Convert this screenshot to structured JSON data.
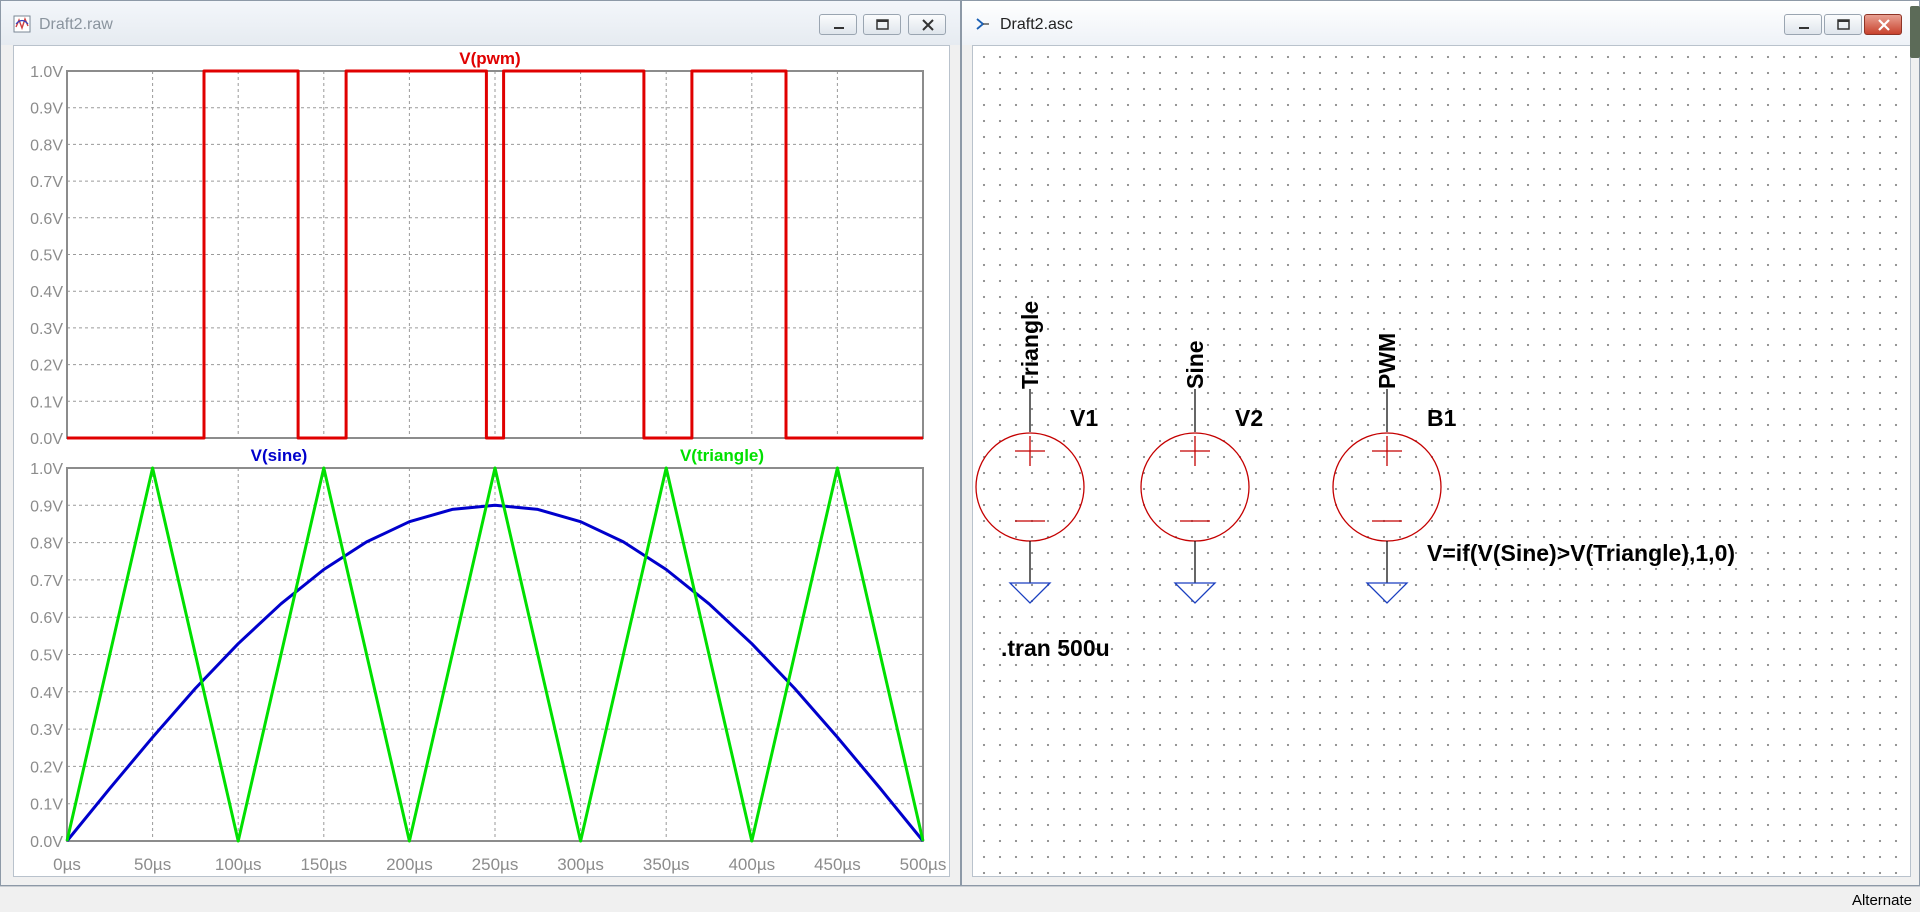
{
  "waveform_window": {
    "title": "Draft2.raw",
    "controls": [
      "minimize",
      "restore",
      "close"
    ]
  },
  "schematic_window": {
    "title": "Draft2.asc",
    "controls": [
      "minimize",
      "restore",
      "close"
    ]
  },
  "status": {
    "text": "Alternate"
  },
  "colors": {
    "pwm": "#e00000",
    "sine": "#0000cc",
    "triangle": "#00e000",
    "component": "#c40000",
    "wire": "#000000",
    "grid": "#888888"
  },
  "chart_data": [
    {
      "type": "line",
      "pane": "top",
      "series": [
        {
          "name": "V(pwm)",
          "color": "#e00000",
          "x": [
            0,
            80,
            80,
            135,
            135,
            163,
            163,
            245,
            245,
            255,
            255,
            337,
            337,
            365,
            365,
            420,
            420,
            500
          ],
          "values": [
            0,
            0,
            1,
            1,
            0,
            0,
            1,
            1,
            0,
            0,
            1,
            1,
            0,
            0,
            1,
            1,
            0,
            0
          ]
        }
      ],
      "xlim": [
        0,
        500
      ],
      "ylim": [
        0,
        1
      ],
      "y_ticks": [
        "0.0V",
        "0.1V",
        "0.2V",
        "0.3V",
        "0.4V",
        "0.5V",
        "0.6V",
        "0.7V",
        "0.8V",
        "0.9V",
        "1.0V"
      ],
      "grid": true
    },
    {
      "type": "line",
      "pane": "bottom",
      "series": [
        {
          "name": "V(sine)",
          "color": "#0000cc",
          "x": [
            0,
            25,
            50,
            75,
            100,
            125,
            150,
            175,
            200,
            225,
            250,
            275,
            300,
            325,
            350,
            375,
            400,
            425,
            450,
            475,
            500
          ],
          "values": [
            0,
            0.141,
            0.278,
            0.409,
            0.529,
            0.636,
            0.728,
            0.802,
            0.856,
            0.889,
            0.9,
            0.889,
            0.856,
            0.802,
            0.728,
            0.636,
            0.529,
            0.409,
            0.278,
            0.141,
            0
          ]
        },
        {
          "name": "V(triangle)",
          "color": "#00e000",
          "x": [
            0,
            50,
            100,
            150,
            200,
            250,
            300,
            350,
            400,
            450,
            500
          ],
          "values": [
            0,
            1,
            0,
            1,
            0,
            1,
            0,
            1,
            0,
            1,
            0
          ]
        }
      ],
      "xlim": [
        0,
        500
      ],
      "ylim": [
        0,
        1
      ],
      "y_ticks": [
        "0.0V",
        "0.1V",
        "0.2V",
        "0.3V",
        "0.4V",
        "0.5V",
        "0.6V",
        "0.7V",
        "0.8V",
        "0.9V",
        "1.0V"
      ],
      "x_ticks": [
        "0µs",
        "50µs",
        "100µs",
        "150µs",
        "200µs",
        "250µs",
        "300µs",
        "350µs",
        "400µs",
        "450µs",
        "500µs"
      ],
      "grid": true
    }
  ],
  "schematic": {
    "components": [
      {
        "ref": "V1",
        "net_label": "Triangle"
      },
      {
        "ref": "V2",
        "net_label": "Sine"
      },
      {
        "ref": "B1",
        "net_label": "PWM"
      }
    ],
    "b1_expression": "V=if(V(Sine)>V(Triangle),1,0)",
    "directive": ".tran 500u"
  }
}
